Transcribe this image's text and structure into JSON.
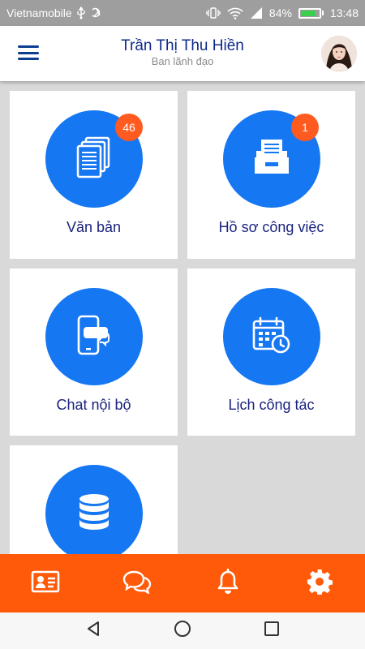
{
  "status_bar": {
    "carrier": "Vietnamobile",
    "battery_percent": "84%",
    "time": "13:48",
    "icons": [
      "usb-icon",
      "app-notification-icon",
      "vibrate-icon",
      "wifi-icon",
      "signal-icon",
      "battery-icon"
    ]
  },
  "header": {
    "user_name": "Trần Thị Thu Hiền",
    "user_role": "Ban lãnh đạo",
    "menu_icon": "hamburger-menu-icon",
    "avatar_icon": "user-avatar"
  },
  "tiles": [
    {
      "label": "Văn bản",
      "icon": "documents-icon",
      "badge": "46"
    },
    {
      "label": "Hồ sơ công việc",
      "icon": "file-drawer-icon",
      "badge": "1"
    },
    {
      "label": "Chat nội bộ",
      "icon": "phone-chat-icon",
      "badge": null
    },
    {
      "label": "Lịch công tác",
      "icon": "calendar-clock-icon",
      "badge": null
    },
    {
      "label": "",
      "icon": "database-icon",
      "badge": null
    }
  ],
  "bottom_nav": [
    {
      "icon": "contact-card-icon"
    },
    {
      "icon": "chat-bubbles-icon"
    },
    {
      "icon": "bell-icon"
    },
    {
      "icon": "gear-icon"
    }
  ],
  "system_nav": [
    {
      "icon": "back-triangle-icon"
    },
    {
      "icon": "home-circle-icon"
    },
    {
      "icon": "recents-square-icon"
    }
  ],
  "colors": {
    "accent_blue": "#1677f2",
    "header_text": "#0d2a8a",
    "badge_orange": "#ff5a1f",
    "bottom_nav_orange": "#ff5a0a",
    "background": "#d9d9d9"
  }
}
